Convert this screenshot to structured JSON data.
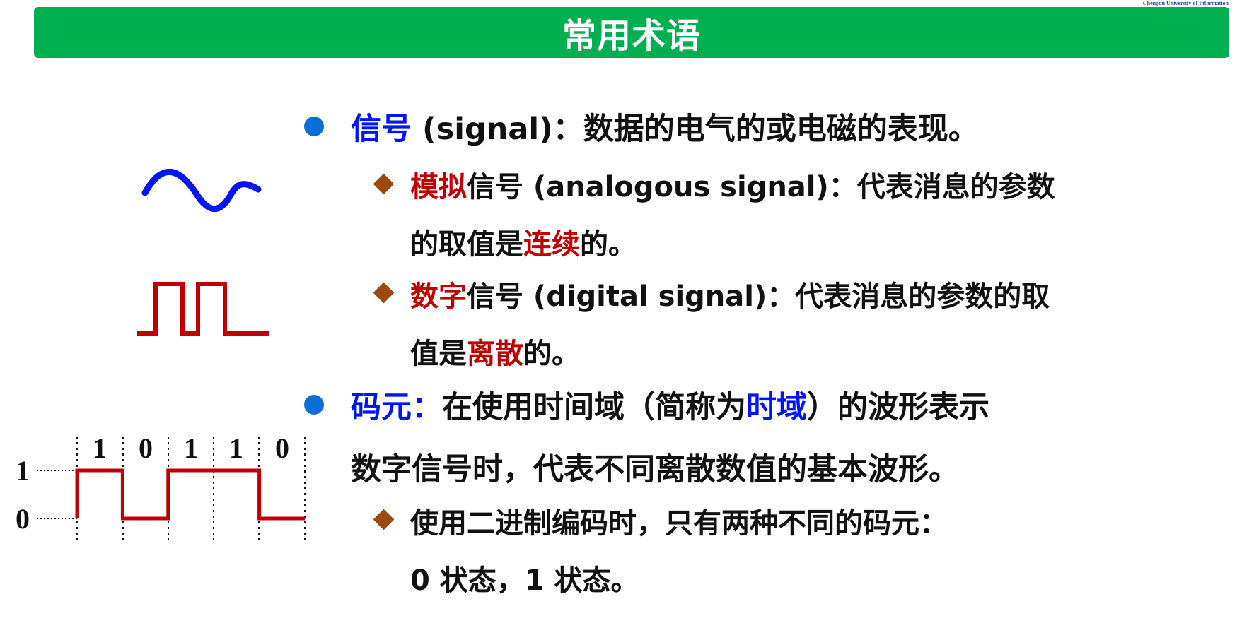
{
  "corner_text": "Chengdu University of Information",
  "title": "常用术语",
  "signal": {
    "term": "信号",
    "rest": " (signal)：数据的电气的或电磁的表现。"
  },
  "analog": {
    "term": "模拟",
    "mid": "信号 (analogous signal)：代表消息的参数",
    "line2_pre": "的取值是",
    "line2_highlight": "连续",
    "line2_post": "的。"
  },
  "digital": {
    "term": "数字",
    "mid": "信号 (digital signal)：代表消息的参数的取",
    "line2_pre": "值是",
    "line2_highlight": "离散",
    "line2_post": "的。"
  },
  "symbol": {
    "term": "码元：",
    "line1_pre": "在使用时间域（简称为",
    "line1_highlight": "时域",
    "line1_post": "）的波形表示",
    "line2": "数字信号时，代表不同离散数值的基本波形。"
  },
  "binary": {
    "line1": "使用二进制编码时，只有两种不同的码元：",
    "line2": "0 状态，1 状态。"
  },
  "bit_diagram": {
    "bits": [
      "1",
      "0",
      "1",
      "1",
      "0"
    ],
    "level_high": "1",
    "level_low": "0"
  },
  "colors": {
    "title_bar": "#00b050",
    "term_blue": "#0015f5",
    "term_red": "#c00000",
    "bullet_dot": "#0b6fd6",
    "bullet_diamond": "#9b4a0f",
    "sine_wave": "#0015f5",
    "square_wave": "#c00000"
  }
}
